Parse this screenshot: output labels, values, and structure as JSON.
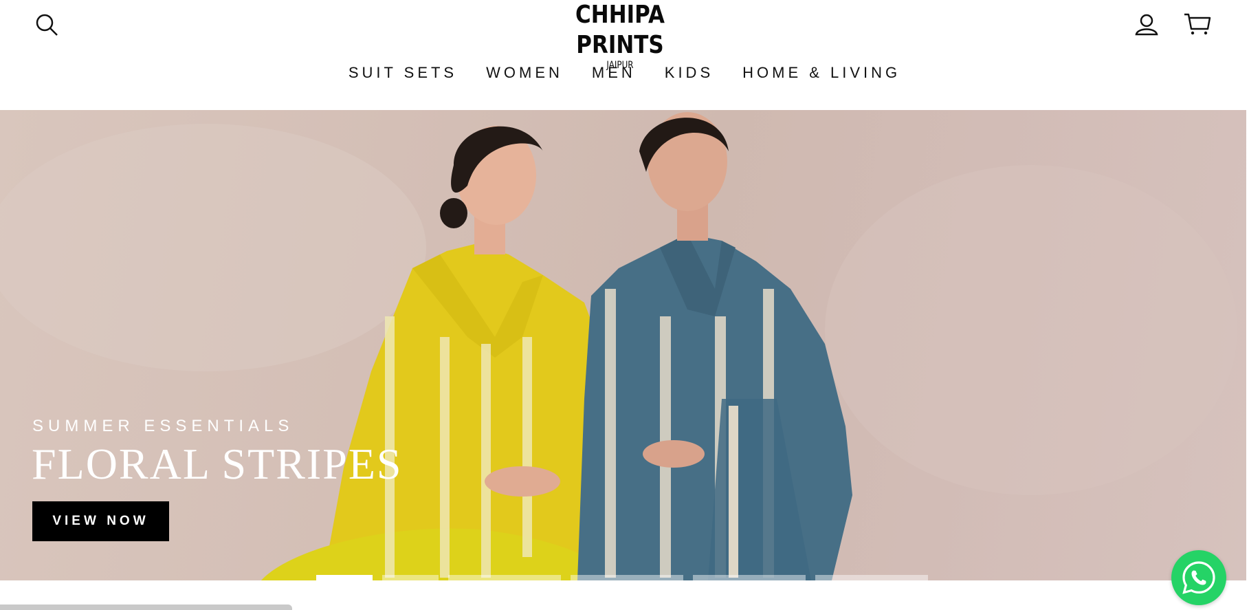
{
  "brand": {
    "name": "CHHIPA PRINTS",
    "location": "JAIPUR"
  },
  "header": {
    "icons": {
      "search": "search-icon",
      "account": "user-icon",
      "cart": "cart-icon"
    }
  },
  "nav": {
    "items": [
      {
        "label": "SUIT SETS"
      },
      {
        "label": "WOMEN"
      },
      {
        "label": "MEN"
      },
      {
        "label": "KIDS"
      },
      {
        "label": "HOME & LIVING"
      }
    ]
  },
  "hero": {
    "kicker": "SUMMER ESSENTIALS",
    "title": "FLORAL STRIPES",
    "cta": "VIEW NOW",
    "slides_total": 6,
    "active_slide": 1
  },
  "floating": {
    "chat_icon": "whatsapp-icon"
  },
  "colors": {
    "background": "#ffffff",
    "hero_bg": "#d4bfb6",
    "cta_bg": "#000000",
    "cta_text": "#ffffff",
    "whatsapp": "#25d366"
  }
}
